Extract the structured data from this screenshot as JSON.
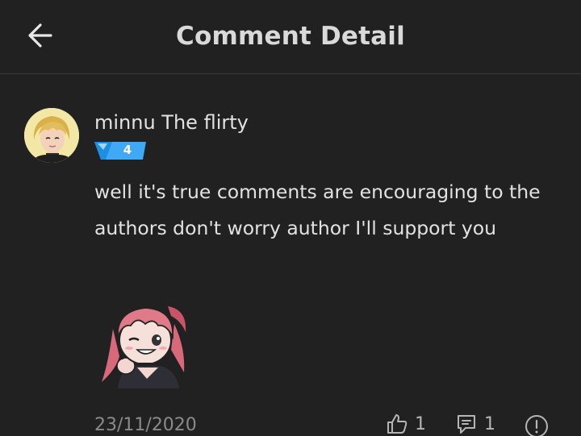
{
  "header": {
    "title": "Comment Detail",
    "back_icon": "arrow-left-icon"
  },
  "comment": {
    "username": "minnu The flirty",
    "level": "4",
    "text": "well it's true comments are encouraging to the authors don't worry author I'll support you",
    "date": "23/11/2020",
    "likes": "1",
    "replies": "1"
  },
  "icons": {
    "like": "thumbs-up-icon",
    "reply": "comment-icon",
    "report": "report-icon"
  },
  "colors": {
    "background": "#212121",
    "badge": "#3fa9f5",
    "text": "#e2e2e2",
    "muted": "#8a8a8a"
  }
}
